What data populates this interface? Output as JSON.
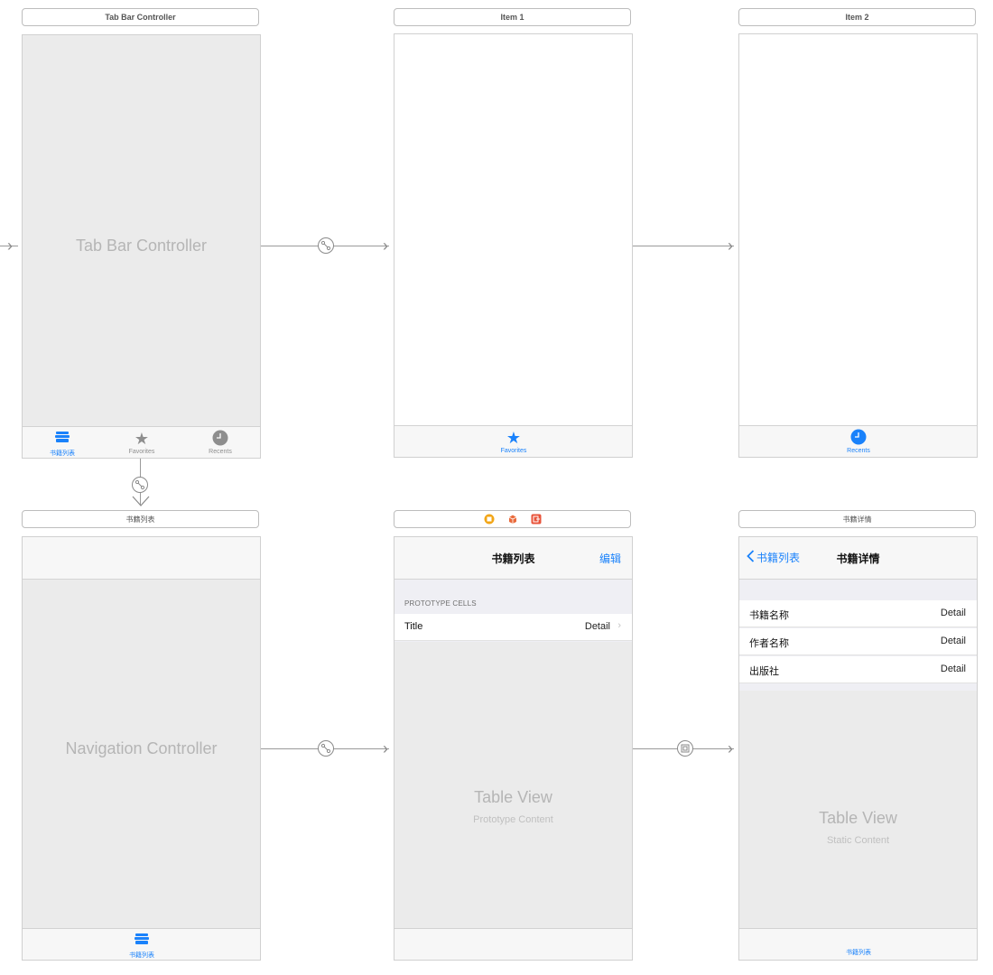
{
  "colors": {
    "accent": "#1a82fb",
    "canvas": "#ffffff",
    "controller_bg": "#ebebeb"
  },
  "scenes": {
    "tab_bar_controller": {
      "title": "Tab Bar Controller",
      "label": "Tab Bar Controller",
      "tabs": [
        {
          "label": "书籍列表",
          "icon": "books-icon",
          "active": true
        },
        {
          "label": "Favorites",
          "icon": "star-icon",
          "active": false
        },
        {
          "label": "Recents",
          "icon": "clock-icon",
          "active": false
        }
      ]
    },
    "item1": {
      "title": "Item 1",
      "tab": {
        "label": "Favorites",
        "icon": "star-icon"
      }
    },
    "item2": {
      "title": "Item 2",
      "tab": {
        "label": "Recents",
        "icon": "clock-icon"
      }
    },
    "navigation_controller": {
      "title": "书籍列表",
      "label": "Navigation Controller",
      "tab": {
        "label": "书籍列表",
        "icon": "books-icon"
      }
    },
    "book_list": {
      "scene_icons": [
        "view-controller-icon",
        "first-responder-icon",
        "exit-icon"
      ],
      "nav_title": "书籍列表",
      "nav_right": "编辑",
      "section_header": "PROTOTYPE CELLS",
      "cell": {
        "title": "Title",
        "detail": "Detail"
      },
      "label": "Table View",
      "sublabel": "Prototype Content"
    },
    "book_detail": {
      "title": "书籍详情",
      "nav_back": "书籍列表",
      "nav_title": "书籍详情",
      "rows": [
        {
          "title": "书籍名称",
          "detail": "Detail"
        },
        {
          "title": "作者名称",
          "detail": "Detail"
        },
        {
          "title": "出版社",
          "detail": "Detail"
        }
      ],
      "label": "Table View",
      "sublabel": "Static Content",
      "tab_label": "书籍列表"
    }
  },
  "segues": [
    {
      "from": "initial",
      "to": "tab_bar_controller",
      "kind": "entry-point"
    },
    {
      "from": "tab_bar_controller",
      "to": "item1",
      "kind": "relationship"
    },
    {
      "from": "item1",
      "to": "item2",
      "kind": "relationship"
    },
    {
      "from": "tab_bar_controller",
      "to": "navigation_controller",
      "kind": "relationship"
    },
    {
      "from": "navigation_controller",
      "to": "book_list",
      "kind": "relationship"
    },
    {
      "from": "book_list",
      "to": "book_detail",
      "kind": "show"
    }
  ]
}
